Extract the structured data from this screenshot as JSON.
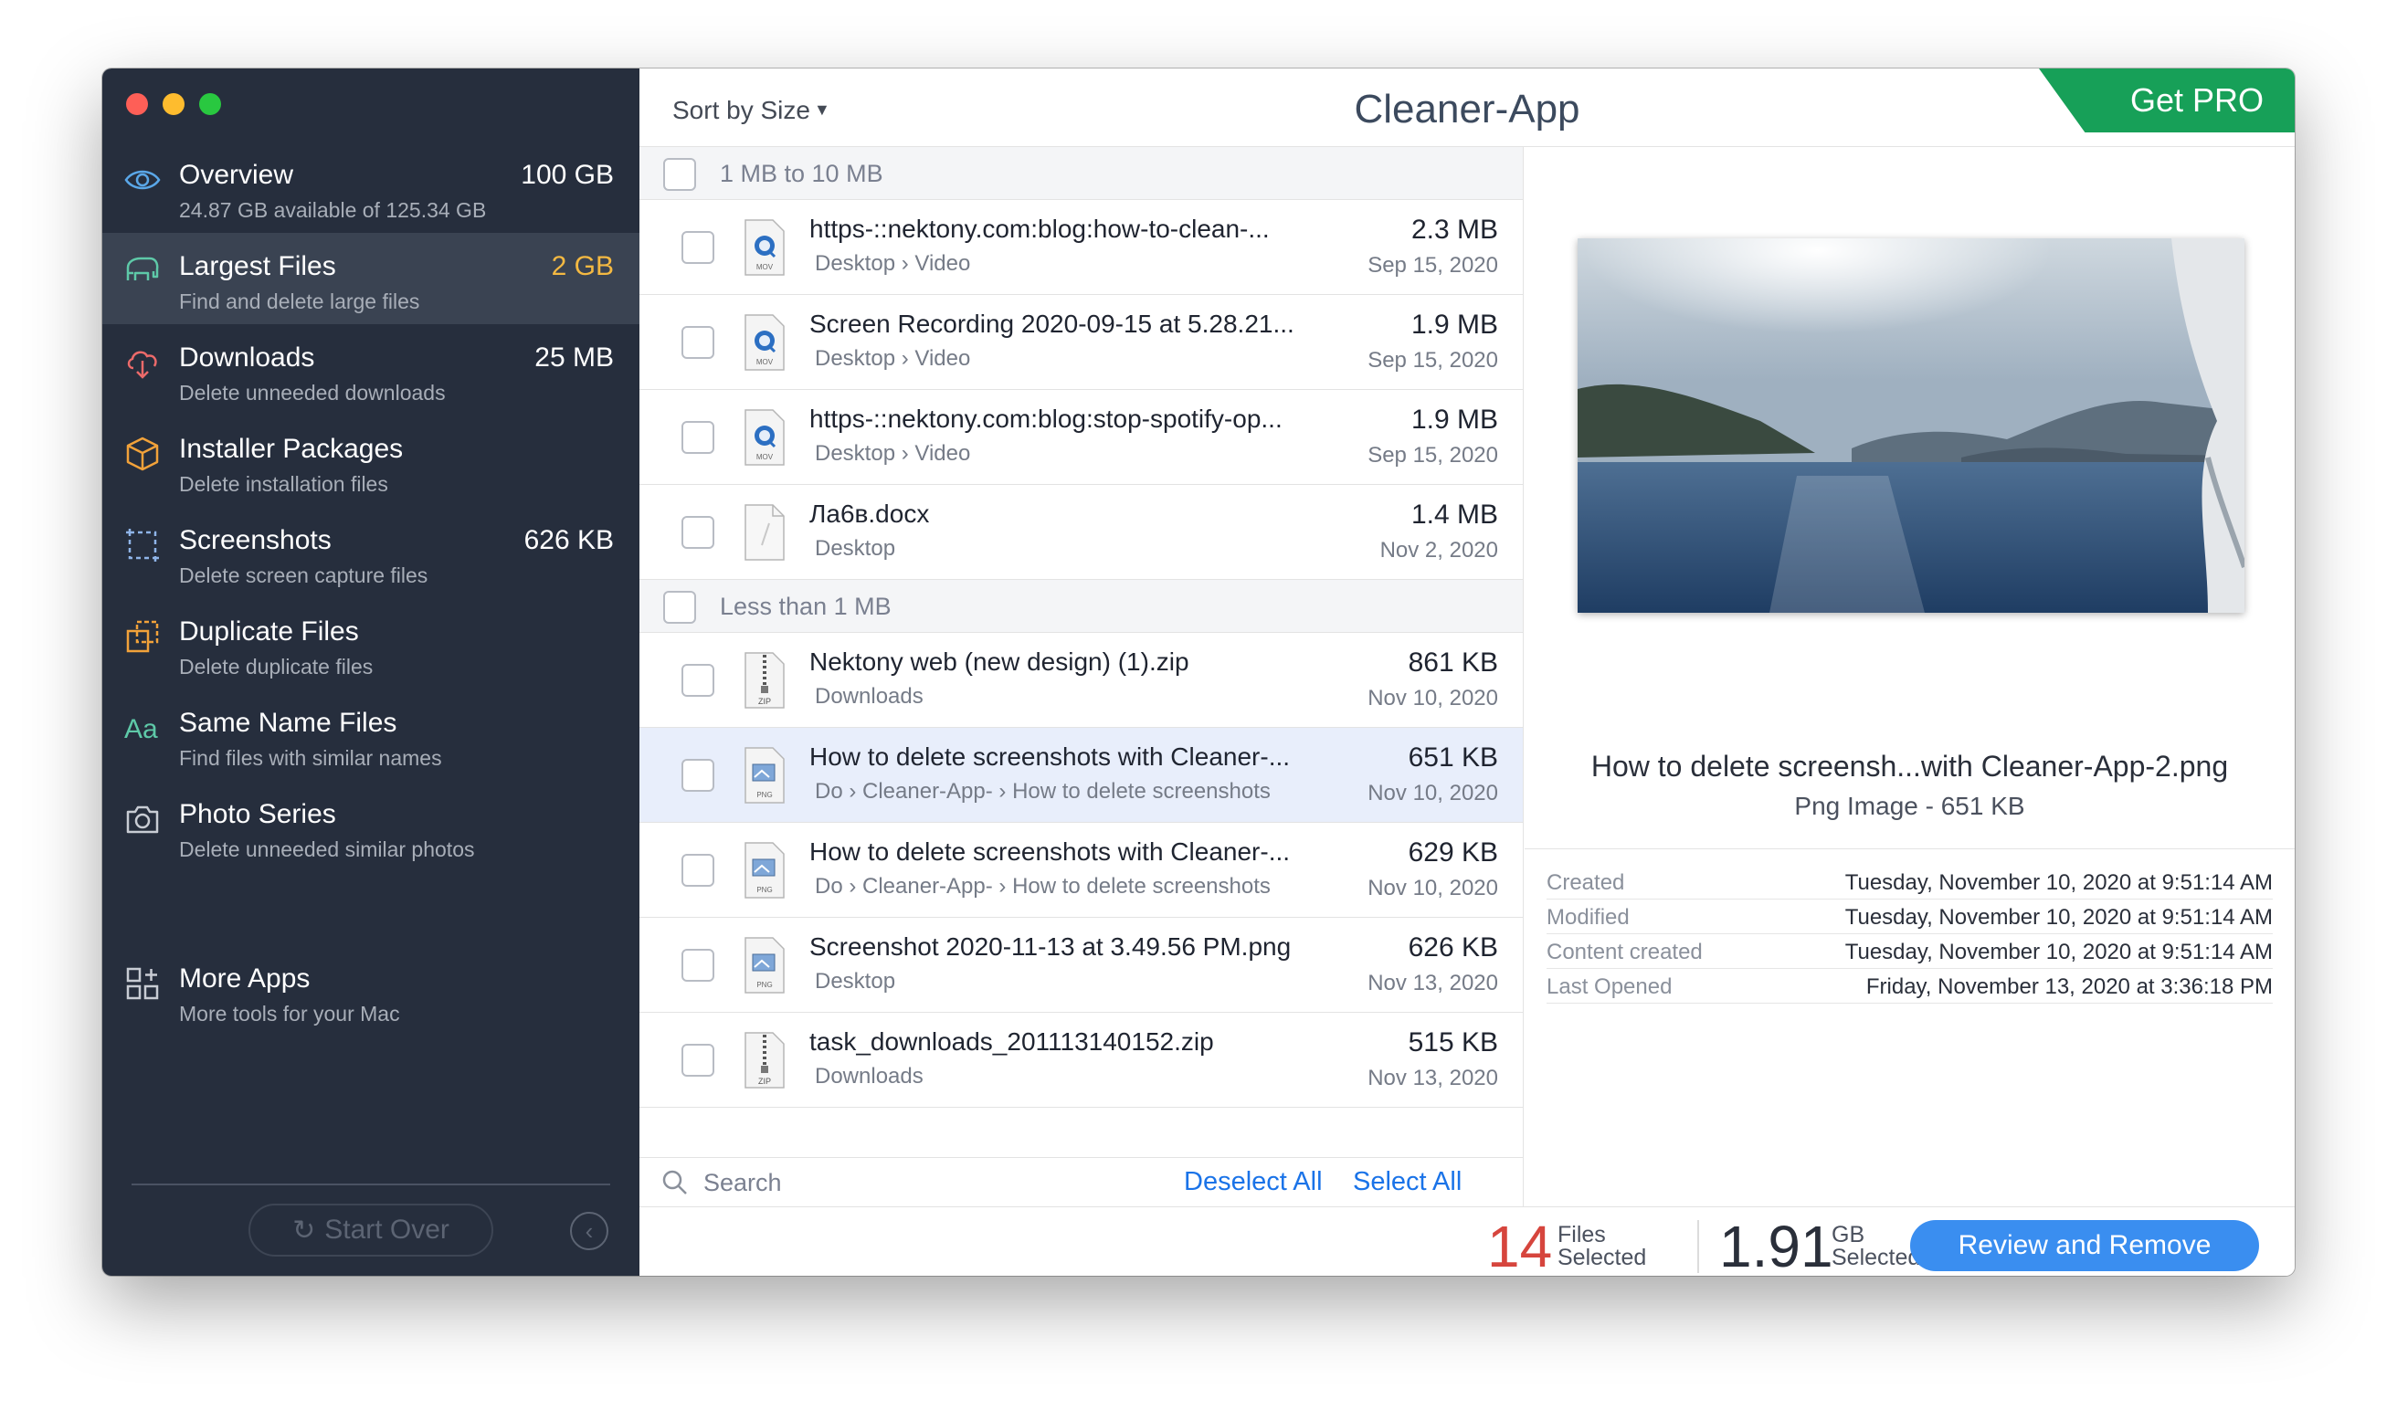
{
  "app_title": "Cleaner-App",
  "get_pro": "Get PRO",
  "sort_label": "Sort by Size",
  "sidebar": {
    "items": [
      {
        "title": "Overview",
        "sub": "24.87 GB available of 125.34 GB",
        "size": "100 GB",
        "icon": "eye-icon"
      },
      {
        "title": "Largest Files",
        "sub": "Find and delete large files",
        "size": "2 GB",
        "icon": "elephant-icon",
        "active": true
      },
      {
        "title": "Downloads",
        "sub": "Delete unneeded downloads",
        "size": "25 MB",
        "icon": "cloud-download-icon"
      },
      {
        "title": "Installer Packages",
        "sub": "Delete installation files",
        "size": "",
        "icon": "package-icon"
      },
      {
        "title": "Screenshots",
        "sub": "Delete screen capture files",
        "size": "626 KB",
        "icon": "screenshot-icon"
      },
      {
        "title": "Duplicate Files",
        "sub": "Delete duplicate files",
        "size": "",
        "icon": "duplicate-icon"
      },
      {
        "title": "Same Name Files",
        "sub": "Find files with similar names",
        "size": "",
        "icon": "font-aa-icon"
      },
      {
        "title": "Photo Series",
        "sub": "Delete unneeded similar photos",
        "size": "",
        "icon": "camera-icon"
      },
      {
        "title": "More Apps",
        "sub": "More tools for your Mac",
        "size": "",
        "icon": "apps-grid-icon"
      }
    ],
    "start_over": "Start Over"
  },
  "list": {
    "groups": [
      {
        "label": "1 MB to 10 MB"
      },
      {
        "label": "Less than 1 MB"
      }
    ],
    "rows": [
      {
        "name": "https-::nektony.com:blog:how-to-clean-...",
        "path": "Desktop › Video",
        "size": "2.3 MB",
        "date": "Sep 15, 2020",
        "type": "MOV"
      },
      {
        "name": "Screen Recording 2020-09-15 at 5.28.21...",
        "path": "Desktop › Video",
        "size": "1.9 MB",
        "date": "Sep 15, 2020",
        "type": "MOV"
      },
      {
        "name": "https-::nektony.com:blog:stop-spotify-op...",
        "path": "Desktop › Video",
        "size": "1.9 MB",
        "date": "Sep 15, 2020",
        "type": "MOV"
      },
      {
        "name": "Ла6в.docx",
        "path": "Desktop",
        "size": "1.4 MB",
        "date": "Nov 2, 2020",
        "type": "DOC"
      },
      {
        "name": "Nektony web (new design) (1).zip",
        "path": "Downloads",
        "size": "861 KB",
        "date": "Nov 10, 2020",
        "type": "ZIP"
      },
      {
        "name": "How to delete screenshots with Cleaner-...",
        "path": "Do › Cleaner-App- › How to delete screenshots",
        "size": "651 KB",
        "date": "Nov 10, 2020",
        "type": "PNG",
        "selected": true
      },
      {
        "name": "How to delete screenshots with Cleaner-...",
        "path": "Do › Cleaner-App- › How to delete screenshots",
        "size": "629 KB",
        "date": "Nov 10, 2020",
        "type": "PNG"
      },
      {
        "name": "Screenshot 2020-11-13 at 3.49.56 PM.png",
        "path": "Desktop",
        "size": "626 KB",
        "date": "Nov 13, 2020",
        "type": "PNG"
      },
      {
        "name": "task_downloads_201113140152.zip",
        "path": "Downloads",
        "size": "515 KB",
        "date": "Nov 13, 2020",
        "type": "ZIP"
      }
    ],
    "search_placeholder": "Search",
    "deselect_all": "Deselect All",
    "select_all": "Select All"
  },
  "preview": {
    "name": "How to delete screensh...with Cleaner-App-2.png",
    "type": "Png Image - 651 KB",
    "meta": [
      {
        "key": "Created",
        "value": "Tuesday, November 10, 2020 at 9:51:14 AM"
      },
      {
        "key": "Modified",
        "value": "Tuesday, November 10, 2020 at 9:51:14 AM"
      },
      {
        "key": "Content created",
        "value": "Tuesday, November 10, 2020 at 9:51:14 AM"
      },
      {
        "key": "Last Opened",
        "value": "Friday, November 13, 2020 at 3:36:18 PM"
      }
    ]
  },
  "footer": {
    "files_count": "14",
    "files_label_1": "Files",
    "files_label_2": "Selected",
    "gb_count": "1.91",
    "gb_label_1": "GB",
    "gb_label_2": "Selected",
    "review_button": "Review and Remove"
  },
  "colors": {
    "sidebar_bg": "#262e3d",
    "accent_blue": "#3a8ef0",
    "pro_green": "#17a058",
    "active_size": "#f4b942",
    "count_red": "#d6453d"
  }
}
